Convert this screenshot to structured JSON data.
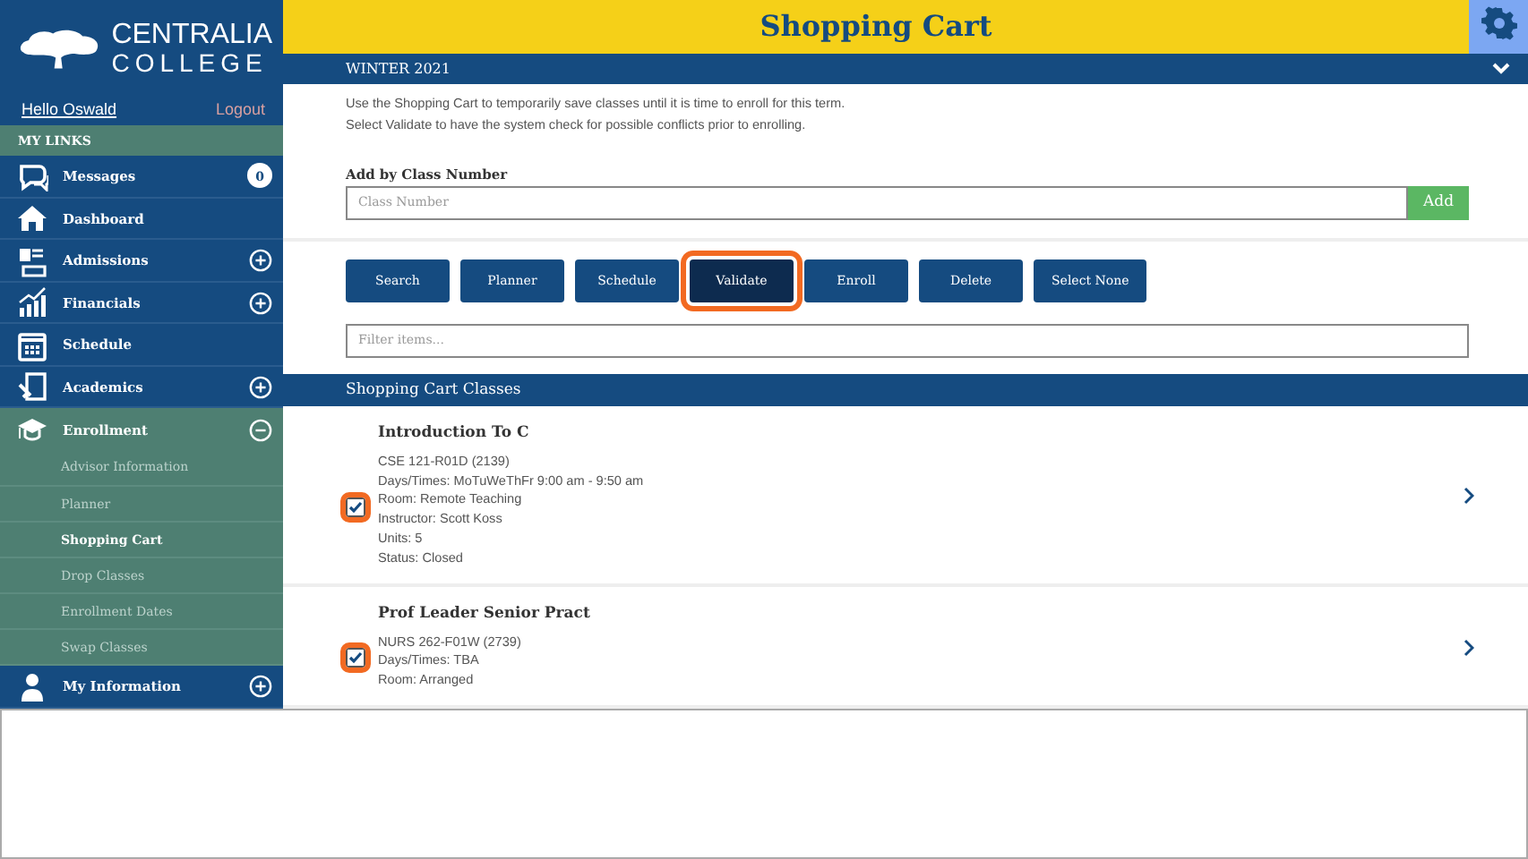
{
  "sidebar": {
    "logo_top": "CENTRALIA",
    "logo_bottom": "COLLEGE",
    "user": "Hello Oswald",
    "logout": "Logout",
    "section": "MY LINKS",
    "items": [
      {
        "label": "Messages",
        "kind": "badge",
        "badge": "0"
      },
      {
        "label": "Dashboard",
        "kind": "plain"
      },
      {
        "label": "Admissions",
        "kind": "expand",
        "expanded": false
      },
      {
        "label": "Financials",
        "kind": "expand",
        "expanded": false
      },
      {
        "label": "Schedule",
        "kind": "plain"
      },
      {
        "label": "Academics",
        "kind": "expand",
        "expanded": false
      },
      {
        "label": "Enrollment",
        "kind": "expand",
        "expanded": true,
        "children": [
          {
            "label": "Advisor Information",
            "selected": false
          },
          {
            "label": "Planner",
            "selected": false
          },
          {
            "label": "Shopping Cart",
            "selected": true
          },
          {
            "label": "Drop Classes",
            "selected": false
          },
          {
            "label": "Enrollment Dates",
            "selected": false
          },
          {
            "label": "Swap Classes",
            "selected": false
          }
        ]
      },
      {
        "label": "My Information",
        "kind": "expand",
        "expanded": false
      }
    ]
  },
  "header": {
    "title": "Shopping Cart"
  },
  "term": {
    "label": "WINTER 2021"
  },
  "intro": [
    "Use the Shopping Cart to temporarily save classes until it is time to enroll for this term.",
    "Select Validate to have the system check for possible conflicts prior to enrolling."
  ],
  "add_field": {
    "label": "Add by Class Number",
    "placeholder": "Class Number",
    "button": "Add"
  },
  "actions": [
    {
      "label": "Search",
      "highlighted": false
    },
    {
      "label": "Planner",
      "highlighted": false
    },
    {
      "label": "Schedule",
      "highlighted": false
    },
    {
      "label": "Validate",
      "highlighted": true
    },
    {
      "label": "Enroll",
      "highlighted": false
    },
    {
      "label": "Delete",
      "highlighted": false
    },
    {
      "label": "Select None",
      "highlighted": false
    }
  ],
  "filter": {
    "placeholder": "Filter items..."
  },
  "section_title": "Shopping Cart Classes",
  "classes": [
    {
      "title": "Introduction To C",
      "checked": true,
      "highlighted": true,
      "details": [
        "CSE 121-R01D (2139)",
        "Days/Times:  MoTuWeThFr 9:00 am - 9:50 am",
        "Room:  Remote Teaching",
        "Instructor: Scott Koss",
        "Units: 5",
        "Status: Closed"
      ]
    },
    {
      "title": "Prof Leader Senior Pract",
      "checked": true,
      "highlighted": true,
      "details": [
        "NURS 262-F01W (2739)",
        "Days/Times:  TBA",
        "Room:  Arranged"
      ]
    }
  ]
}
